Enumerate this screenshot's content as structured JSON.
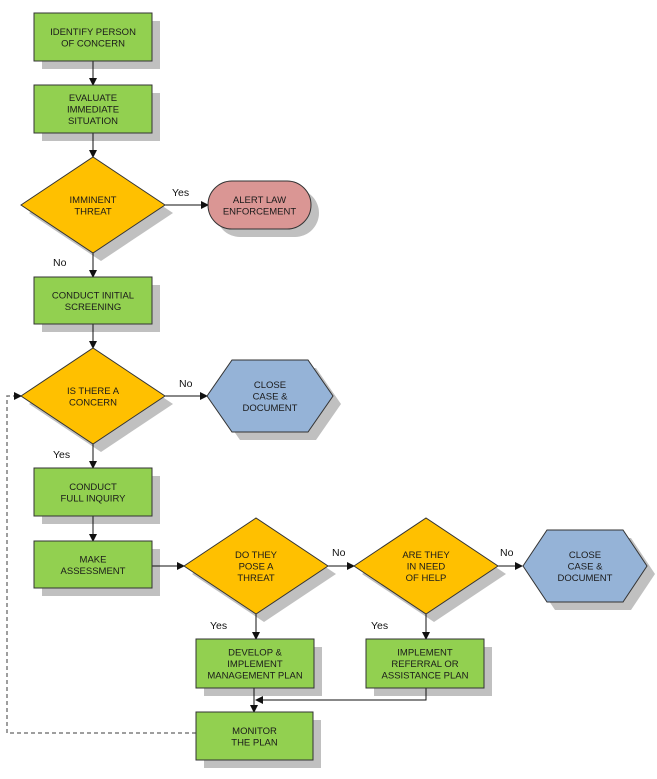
{
  "diagram": {
    "type": "flowchart",
    "colors": {
      "process": "#92d050",
      "decision": "#ffc000",
      "alert": "#da9694",
      "close": "#95b3d7",
      "stroke": "#333333",
      "shadow": "#c0c0c0",
      "dashed": "#7f7f7f"
    },
    "nodes": [
      {
        "id": "identify",
        "kind": "process",
        "lines": [
          "IDENTIFY PERSON",
          "OF CONCERN"
        ]
      },
      {
        "id": "evaluate",
        "kind": "process",
        "lines": [
          "EVALUATE",
          "IMMEDIATE",
          "SITUATION"
        ]
      },
      {
        "id": "imminent",
        "kind": "decision",
        "lines": [
          "IMMINENT",
          "THREAT"
        ]
      },
      {
        "id": "alert",
        "kind": "alert",
        "lines": [
          "ALERT LAW",
          "ENFORCEMENT"
        ]
      },
      {
        "id": "screening",
        "kind": "process",
        "lines": [
          "CONDUCT INITIAL",
          "SCREENING"
        ]
      },
      {
        "id": "concern",
        "kind": "decision",
        "lines": [
          "IS THERE A",
          "CONCERN"
        ]
      },
      {
        "id": "close1",
        "kind": "close",
        "lines": [
          "CLOSE",
          "CASE &",
          "DOCUMENT"
        ]
      },
      {
        "id": "inquiry",
        "kind": "process",
        "lines": [
          "CONDUCT",
          "FULL INQUIRY"
        ]
      },
      {
        "id": "assessment",
        "kind": "process",
        "lines": [
          "MAKE",
          "ASSESSMENT"
        ]
      },
      {
        "id": "pose",
        "kind": "decision",
        "lines": [
          "DO THEY",
          "POSE A",
          "THREAT"
        ]
      },
      {
        "id": "need",
        "kind": "decision",
        "lines": [
          "ARE THEY",
          "IN NEED",
          "OF HELP"
        ]
      },
      {
        "id": "close2",
        "kind": "close",
        "lines": [
          "CLOSE",
          "CASE &",
          "DOCUMENT"
        ]
      },
      {
        "id": "develop",
        "kind": "process",
        "lines": [
          "DEVELOP &",
          "IMPLEMENT",
          "MANAGEMENT PLAN"
        ]
      },
      {
        "id": "referral",
        "kind": "process",
        "lines": [
          "IMPLEMENT",
          "REFERRAL OR",
          "ASSISTANCE PLAN"
        ]
      },
      {
        "id": "monitor",
        "kind": "process",
        "lines": [
          "MONITOR",
          "THE PLAN"
        ]
      }
    ],
    "edges": [
      {
        "from": "identify",
        "to": "evaluate",
        "label": ""
      },
      {
        "from": "evaluate",
        "to": "imminent",
        "label": ""
      },
      {
        "from": "imminent",
        "to": "alert",
        "label": "Yes"
      },
      {
        "from": "imminent",
        "to": "screening",
        "label": "No"
      },
      {
        "from": "screening",
        "to": "concern",
        "label": ""
      },
      {
        "from": "concern",
        "to": "close1",
        "label": "No"
      },
      {
        "from": "concern",
        "to": "inquiry",
        "label": "Yes"
      },
      {
        "from": "inquiry",
        "to": "assessment",
        "label": ""
      },
      {
        "from": "assessment",
        "to": "pose",
        "label": ""
      },
      {
        "from": "pose",
        "to": "need",
        "label": "No"
      },
      {
        "from": "pose",
        "to": "develop",
        "label": "Yes"
      },
      {
        "from": "need",
        "to": "close2",
        "label": "No"
      },
      {
        "from": "need",
        "to": "referral",
        "label": "Yes"
      },
      {
        "from": "develop",
        "to": "monitor",
        "label": ""
      },
      {
        "from": "referral",
        "to": "monitor",
        "label": ""
      },
      {
        "from": "monitor",
        "to": "concern",
        "label": "",
        "style": "dashed"
      }
    ]
  }
}
